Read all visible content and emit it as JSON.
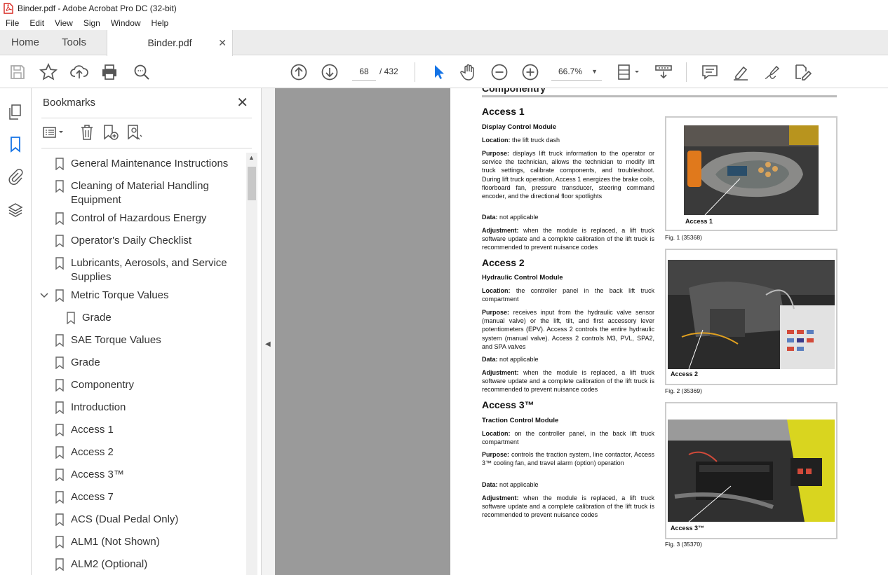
{
  "window": {
    "title": "Binder.pdf - Adobe Acrobat Pro DC (32-bit)"
  },
  "menu": [
    "File",
    "Edit",
    "View",
    "Sign",
    "Window",
    "Help"
  ],
  "tabs": {
    "home": "Home",
    "tools": "Tools",
    "document": "Binder.pdf"
  },
  "toolbar": {
    "current_page": "68",
    "page_total": "/ 432",
    "zoom": "66.7%"
  },
  "bookmarks": {
    "title": "Bookmarks",
    "items": [
      "General Maintenance Instructions",
      "Cleaning of Material Handling",
      "Equipment",
      "Control of Hazardous Energy",
      "Operator's Daily Checklist",
      "Lubricants, Aerosols, and Service",
      "Supplies",
      "Metric Torque Values",
      "Grade",
      "SAE Torque Values",
      "Grade",
      "Componentry",
      "Introduction",
      "Access 1",
      "Access 2",
      "Access 3™",
      "Access 7",
      "ACS (Dual Pedal Only)",
      "ALM1 (Not Shown)",
      "ALM2 (Optional)"
    ]
  },
  "document": {
    "section_heading": "Componentry",
    "access1": {
      "heading": "Access 1",
      "subheading": "Display Control Module",
      "location_label": "Location:",
      "location": " the lift truck dash",
      "purpose_label": "Purpose:",
      "purpose": " displays lift truck information to the operator or service the technician, allows the technician to modify lift truck settings, calibrate components, and troubleshoot. During lift truck operation, Access 1 energizes the brake coils, floorboard fan, pressure transducer, steering command encoder, and the directional floor spotlights",
      "data_label": "Data:",
      "data": " not applicable",
      "adjustment_label": "Adjustment:",
      "adjustment": " when the module is replaced, a lift truck software update and a complete calibration of the lift truck is recommended to prevent nuisance codes",
      "fig_label": "Access 1",
      "fig_caption": "Fig. 1 (35368)"
    },
    "access2": {
      "heading": "Access 2",
      "subheading": "Hydraulic Control Module",
      "location_label": "Location:",
      "location": " the controller panel in the back lift truck compartment",
      "purpose_label": "Purpose:",
      "purpose": " receives input from the hydraulic valve sensor (manual valve) or the lift, tilt, and first accessory lever potentiometers (EPV). Access 2 controls the entire hydraulic system (manual valve). Access 2 controls M3, PVL, SPA2, and SPA valves",
      "data_label": "Data:",
      "data": " not applicable",
      "adjustment_label": "Adjustment:",
      "adjustment": " when the module is replaced, a lift truck software update and a complete calibration of the lift truck is recommended to prevent nuisance codes",
      "fig_label": "Access 2",
      "fig_caption": "Fig. 2 (35369)"
    },
    "access3": {
      "heading": "Access 3™",
      "subheading": "Traction Control Module",
      "location_label": "Location:",
      "location": " on the controller panel, in the back lift truck compartment",
      "purpose_label": "Purpose:",
      "purpose": " controls the traction system, line contactor, Access 3™ cooling fan, and travel alarm (option) operation",
      "data_label": "Data:",
      "data": " not applicable",
      "adjustment_label": "Adjustment:",
      "adjustment": " when the module is replaced, a lift truck software update and a complete calibration of the lift truck is recommended to prevent nuisance codes",
      "fig_label": "Access 3™",
      "fig_caption": "Fig. 3 (35370)"
    }
  },
  "colors": {
    "accent_blue": "#1473e6",
    "pdf_red": "#d7261f",
    "viewer_gray": "#9a9a9a"
  }
}
